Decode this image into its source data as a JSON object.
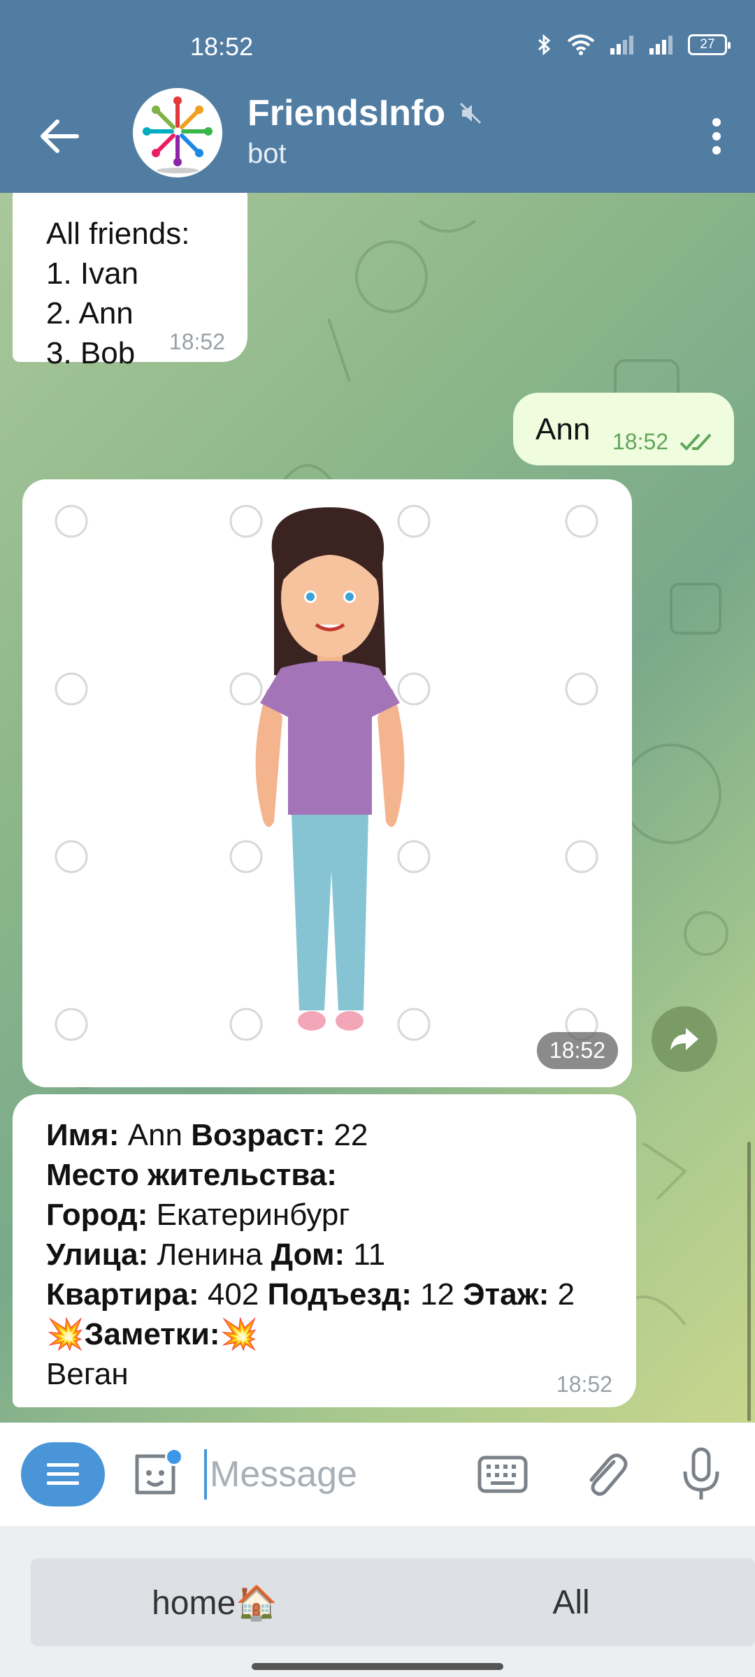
{
  "status_bar": {
    "time": "18:52",
    "battery": "27"
  },
  "header": {
    "title": "FriendsInfo",
    "subtitle": "bot"
  },
  "messages": {
    "list": {
      "lines": [
        "All friends:",
        "1. Ivan",
        "2. Ann",
        "3. Bob"
      ],
      "time": "18:52"
    },
    "outgoing": {
      "text": "Ann",
      "time": "18:52"
    },
    "photo": {
      "time": "18:52"
    },
    "info": {
      "name_label": "Имя:",
      "name_value": " Ann ",
      "age_label": "Возраст:",
      "age_value": " 22",
      "residence_label": "Место жительства:",
      "city_label": "Город:",
      "city_value": " Екатеринбург",
      "street_label": "Улица:",
      "street_value": " Ленина ",
      "house_label": "Дом:",
      "house_value": " 11",
      "flat_label": "Квартира:",
      "flat_value": " 402 ",
      "entrance_label": "Подъезд:",
      "entrance_value": " 12 ",
      "floor_label": "Этаж:",
      "floor_value": " 2",
      "notes_emoji": "💥",
      "notes_label": "Заметки:",
      "notes_value": " Веган",
      "time": "18:52"
    }
  },
  "input": {
    "placeholder": "Message"
  },
  "keyboard": {
    "buttons": [
      "home🏠",
      "All"
    ]
  },
  "colors": {
    "header": "#527da3",
    "accent": "#4a95d8",
    "outgoing_bubble": "#effdde"
  }
}
